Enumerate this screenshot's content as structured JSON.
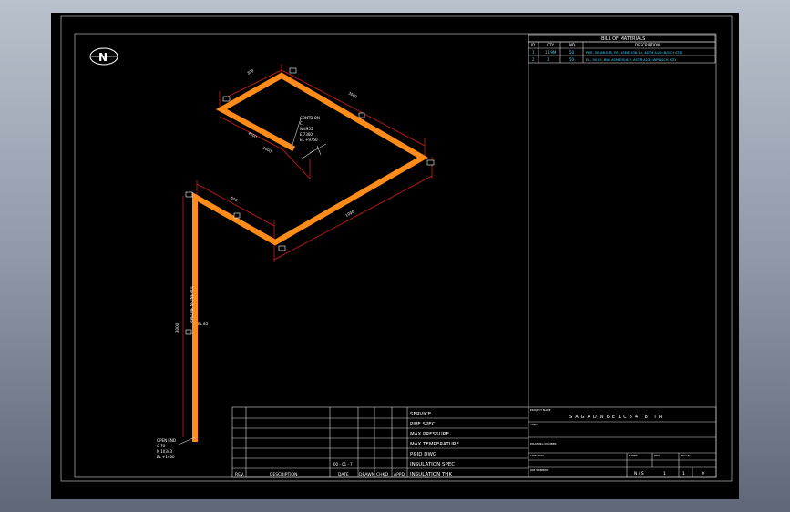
{
  "north_label": "N",
  "bom": {
    "title": "BILL OF MATERIALS",
    "headers": [
      "ID",
      "QTY",
      "ND",
      "DESCRIPTION"
    ],
    "rows": [
      [
        "1",
        "11.9M",
        "50",
        "PIPE, SEAMLESS, PE, ASME B36.10, ASTM A106-B/SCH STD"
      ],
      [
        "2",
        "3",
        "50",
        "ELL 90 LR, BW, ASME B16.9, ASTM A234-WPB/SCH STD"
      ]
    ]
  },
  "dims": {
    "d1": "300",
    "d2": "3000",
    "d3": "4000",
    "d4": "1000",
    "d5": "500",
    "d6": "1000",
    "d7": "3000"
  },
  "callouts": {
    "top": [
      "CONTD ON",
      "C",
      "N 4955",
      "E 7360",
      "EL +9750"
    ],
    "bottom": [
      "OPEN END",
      "C 70",
      "N 10343",
      "EL +1400"
    ],
    "elev": "EL 85"
  },
  "vertical_label": "PIPELINE N-LINE-001",
  "titleblock": {
    "props": [
      "SERVICE",
      "PIPE SPEC",
      "MAX PRESSURE",
      "MAX TEMPERATURE",
      "P&ID DWG",
      "INSULATION SPEC",
      "INSULATION THK"
    ],
    "revision_headers": [
      "REV.",
      "DESCRIPTION",
      "DATE",
      "DRAWN",
      "CHKD",
      "APPD"
    ],
    "rev_stamp": "00 - 01 - 7",
    "project_label": "PROJECT NAME",
    "project_name": "SAGADW6E1C54 8 IR",
    "area_label": "AREA",
    "drawing_label": "DRAWING NUMBER",
    "line_label": "LINE NUM",
    "job_label": "JOB NUMBER",
    "sheet_label": "SHEET",
    "rev_label": "REV",
    "scale_label": "SCALE",
    "sheet_value": "N / S",
    "sheet_num": "1",
    "sheet_of": "1",
    "rev_value": "0"
  }
}
